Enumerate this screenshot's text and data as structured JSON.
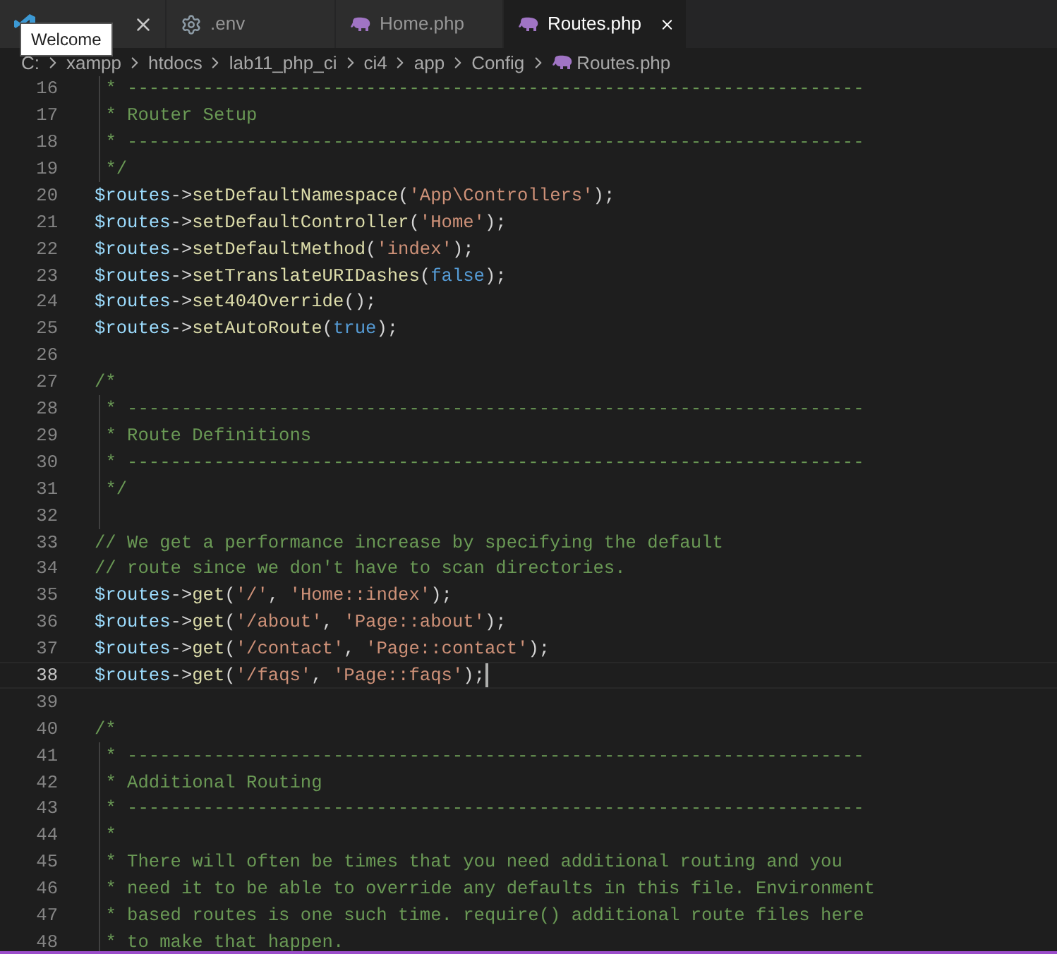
{
  "tabs": [
    {
      "kind": "welcome",
      "selected": false,
      "closable": true
    },
    {
      "kind": "settings",
      "label": ".env",
      "selected": false,
      "closable": false
    },
    {
      "kind": "php",
      "label": "Home.php",
      "selected": false,
      "closable": false
    },
    {
      "kind": "php",
      "label": "Routes.php",
      "selected": true,
      "closable": true
    }
  ],
  "tooltip": "Welcome",
  "breadcrumb": [
    {
      "kind": "folder",
      "label": "C:"
    },
    {
      "kind": "folder",
      "label": "xampp"
    },
    {
      "kind": "folder",
      "label": "htdocs"
    },
    {
      "kind": "folder",
      "label": "lab11_php_ci"
    },
    {
      "kind": "folder",
      "label": "ci4"
    },
    {
      "kind": "folder",
      "label": "app"
    },
    {
      "kind": "folder",
      "label": "Config"
    },
    {
      "kind": "php",
      "label": "Routes.php"
    }
  ],
  "lines": [
    {
      "number": "16",
      "guide": true,
      "current": false,
      "tokens": [
        {
          "kind": "comment",
          "text": "* --------------------------------------------------------------------"
        }
      ]
    },
    {
      "number": "17",
      "guide": true,
      "current": false,
      "tokens": [
        {
          "kind": "comment",
          "text": "* Router Setup"
        }
      ]
    },
    {
      "number": "18",
      "guide": true,
      "current": false,
      "tokens": [
        {
          "kind": "comment",
          "text": "* --------------------------------------------------------------------"
        }
      ]
    },
    {
      "number": "19",
      "guide": true,
      "current": false,
      "tokens": [
        {
          "kind": "comment",
          "text": "*/"
        }
      ]
    },
    {
      "number": "20",
      "guide": false,
      "current": false,
      "tokens": [
        {
          "kind": "variable",
          "text": "$routes"
        },
        {
          "kind": "plain",
          "text": "->"
        },
        {
          "kind": "function",
          "text": "setDefaultNamespace"
        },
        {
          "kind": "plain",
          "text": "("
        },
        {
          "kind": "string",
          "text": "'App\\Controllers'"
        },
        {
          "kind": "plain",
          "text": ");"
        }
      ]
    },
    {
      "number": "21",
      "guide": false,
      "current": false,
      "tokens": [
        {
          "kind": "variable",
          "text": "$routes"
        },
        {
          "kind": "plain",
          "text": "->"
        },
        {
          "kind": "function",
          "text": "setDefaultController"
        },
        {
          "kind": "plain",
          "text": "("
        },
        {
          "kind": "string",
          "text": "'Home'"
        },
        {
          "kind": "plain",
          "text": ");"
        }
      ]
    },
    {
      "number": "22",
      "guide": false,
      "current": false,
      "tokens": [
        {
          "kind": "variable",
          "text": "$routes"
        },
        {
          "kind": "plain",
          "text": "->"
        },
        {
          "kind": "function",
          "text": "setDefaultMethod"
        },
        {
          "kind": "plain",
          "text": "("
        },
        {
          "kind": "string",
          "text": "'index'"
        },
        {
          "kind": "plain",
          "text": ");"
        }
      ]
    },
    {
      "number": "23",
      "guide": false,
      "current": false,
      "tokens": [
        {
          "kind": "variable",
          "text": "$routes"
        },
        {
          "kind": "plain",
          "text": "->"
        },
        {
          "kind": "function",
          "text": "setTranslateURIDashes"
        },
        {
          "kind": "plain",
          "text": "("
        },
        {
          "kind": "keyword",
          "text": "false"
        },
        {
          "kind": "plain",
          "text": ");"
        }
      ]
    },
    {
      "number": "24",
      "guide": false,
      "current": false,
      "tokens": [
        {
          "kind": "variable",
          "text": "$routes"
        },
        {
          "kind": "plain",
          "text": "->"
        },
        {
          "kind": "function",
          "text": "set404Override"
        },
        {
          "kind": "plain",
          "text": "();"
        }
      ]
    },
    {
      "number": "25",
      "guide": false,
      "current": false,
      "tokens": [
        {
          "kind": "variable",
          "text": "$routes"
        },
        {
          "kind": "plain",
          "text": "->"
        },
        {
          "kind": "function",
          "text": "setAutoRoute"
        },
        {
          "kind": "plain",
          "text": "("
        },
        {
          "kind": "keyword",
          "text": "true"
        },
        {
          "kind": "plain",
          "text": ");"
        }
      ]
    },
    {
      "number": "26",
      "guide": false,
      "current": false
    },
    {
      "number": "27",
      "guide": false,
      "current": false,
      "tokens": [
        {
          "kind": "comment",
          "text": "/*"
        }
      ]
    },
    {
      "number": "28",
      "guide": true,
      "current": false,
      "tokens": [
        {
          "kind": "comment",
          "text": "* --------------------------------------------------------------------"
        }
      ]
    },
    {
      "number": "29",
      "guide": true,
      "current": false,
      "tokens": [
        {
          "kind": "comment",
          "text": "* Route Definitions"
        }
      ]
    },
    {
      "number": "30",
      "guide": true,
      "current": false,
      "tokens": [
        {
          "kind": "comment",
          "text": "* --------------------------------------------------------------------"
        }
      ]
    },
    {
      "number": "31",
      "guide": true,
      "current": false,
      "tokens": [
        {
          "kind": "comment",
          "text": "*/"
        }
      ]
    },
    {
      "number": "32",
      "guide": true,
      "current": false
    },
    {
      "number": "33",
      "guide": false,
      "current": false,
      "tokens": [
        {
          "kind": "comment",
          "text": "// We get a performance increase by specifying the default"
        }
      ]
    },
    {
      "number": "34",
      "guide": false,
      "current": false,
      "tokens": [
        {
          "kind": "comment",
          "text": "// route since we don't have to scan directories."
        }
      ]
    },
    {
      "number": "35",
      "guide": false,
      "current": false,
      "tokens": [
        {
          "kind": "variable",
          "text": "$routes"
        },
        {
          "kind": "plain",
          "text": "->"
        },
        {
          "kind": "function",
          "text": "get"
        },
        {
          "kind": "plain",
          "text": "("
        },
        {
          "kind": "string",
          "text": "'/'"
        },
        {
          "kind": "plain",
          "text": ", "
        },
        {
          "kind": "string",
          "text": "'Home::index'"
        },
        {
          "kind": "plain",
          "text": ");"
        }
      ]
    },
    {
      "number": "36",
      "guide": false,
      "current": false,
      "tokens": [
        {
          "kind": "variable",
          "text": "$routes"
        },
        {
          "kind": "plain",
          "text": "->"
        },
        {
          "kind": "function",
          "text": "get"
        },
        {
          "kind": "plain",
          "text": "("
        },
        {
          "kind": "string",
          "text": "'/about'"
        },
        {
          "kind": "plain",
          "text": ", "
        },
        {
          "kind": "string",
          "text": "'Page::about'"
        },
        {
          "kind": "plain",
          "text": ");"
        }
      ]
    },
    {
      "number": "37",
      "guide": false,
      "current": false,
      "tokens": [
        {
          "kind": "variable",
          "text": "$routes"
        },
        {
          "kind": "plain",
          "text": "->"
        },
        {
          "kind": "function",
          "text": "get"
        },
        {
          "kind": "plain",
          "text": "("
        },
        {
          "kind": "string",
          "text": "'/contact'"
        },
        {
          "kind": "plain",
          "text": ", "
        },
        {
          "kind": "string",
          "text": "'Page::contact'"
        },
        {
          "kind": "plain",
          "text": ");"
        }
      ]
    },
    {
      "number": "38",
      "guide": false,
      "current": true,
      "tokens": [
        {
          "kind": "variable",
          "text": "$routes"
        },
        {
          "kind": "plain",
          "text": "->"
        },
        {
          "kind": "function",
          "text": "get"
        },
        {
          "kind": "plain",
          "text": "("
        },
        {
          "kind": "string",
          "text": "'/faqs'"
        },
        {
          "kind": "plain",
          "text": ", "
        },
        {
          "kind": "string",
          "text": "'Page::faqs'"
        },
        {
          "kind": "plain",
          "text": ");"
        }
      ]
    },
    {
      "number": "39",
      "guide": false,
      "current": false
    },
    {
      "number": "40",
      "guide": false,
      "current": false,
      "tokens": [
        {
          "kind": "comment",
          "text": "/*"
        }
      ]
    },
    {
      "number": "41",
      "guide": true,
      "current": false,
      "tokens": [
        {
          "kind": "comment",
          "text": "* --------------------------------------------------------------------"
        }
      ]
    },
    {
      "number": "42",
      "guide": true,
      "current": false,
      "tokens": [
        {
          "kind": "comment",
          "text": "* Additional Routing"
        }
      ]
    },
    {
      "number": "43",
      "guide": true,
      "current": false,
      "tokens": [
        {
          "kind": "comment",
          "text": "* --------------------------------------------------------------------"
        }
      ]
    },
    {
      "number": "44",
      "guide": true,
      "current": false,
      "tokens": [
        {
          "kind": "comment",
          "text": "*"
        }
      ]
    },
    {
      "number": "45",
      "guide": true,
      "current": false,
      "tokens": [
        {
          "kind": "comment",
          "text": "* There will often be times that you need additional routing and you"
        }
      ]
    },
    {
      "number": "46",
      "guide": true,
      "current": false,
      "tokens": [
        {
          "kind": "comment",
          "text": "* need it to be able to override any defaults in this file. Environment"
        }
      ]
    },
    {
      "number": "47",
      "guide": true,
      "current": false,
      "tokens": [
        {
          "kind": "comment",
          "text": "* based routes is one such time. require() additional route files here"
        }
      ]
    },
    {
      "number": "48",
      "guide": true,
      "current": false,
      "tokens": [
        {
          "kind": "comment",
          "text": "* to make that happen."
        }
      ]
    }
  ]
}
